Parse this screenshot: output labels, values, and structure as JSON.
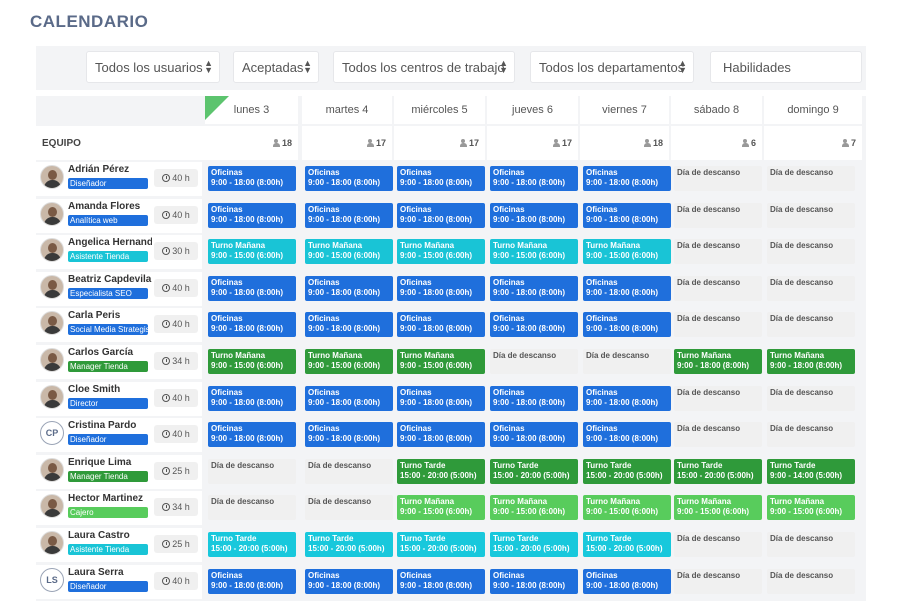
{
  "page_title": "CALENDARIO",
  "filters": [
    {
      "label": "Todos los usuarios",
      "dropdown": true
    },
    {
      "label": "Aceptadas",
      "dropdown": true
    },
    {
      "label": "Todos los centros de trabajo",
      "dropdown": true
    },
    {
      "label": "Todos los departamentos",
      "dropdown": true
    },
    {
      "label": "Habilidades",
      "dropdown": false
    }
  ],
  "team_header": "EQUIPO",
  "days": [
    {
      "label": "lunes 3",
      "count": "18"
    },
    {
      "label": "martes 4",
      "count": "17"
    },
    {
      "label": "miércoles 5",
      "count": "17"
    },
    {
      "label": "jueves 6",
      "count": "17"
    },
    {
      "label": "viernes 7",
      "count": "18"
    },
    {
      "label": "sábado 8",
      "count": "6"
    },
    {
      "label": "domingo 9",
      "count": "7"
    }
  ],
  "shift_colors": {
    "O": "#1f6fdc",
    "M": "#19c4d6",
    "MD": "#2f9a3a",
    "T": "#18c8dc",
    "TD": "#2f9a3a",
    "ML": "#58cc5c",
    "R": "#f0f0f0"
  },
  "shift_text": {
    "O": [
      "Oficinas",
      "9:00 - 18:00 (8:00h)"
    ],
    "M": [
      "Turno Mañana",
      "9:00 - 15:00 (6:00h)"
    ],
    "MD": [
      "Turno Mañana",
      "9:00 - 15:00 (6:00h)"
    ],
    "MD8": [
      "Turno Mañana",
      "9:00 - 18:00 (8:00h)"
    ],
    "T": [
      "Turno Tarde",
      "15:00 - 20:00 (5:00h)"
    ],
    "TD": [
      "Turno Tarde",
      "15:00 - 20:00 (5:00h)"
    ],
    "TD9": [
      "Turno Tarde",
      "9:00 - 14:00 (5:00h)"
    ],
    "ML": [
      "Turno Mañana",
      "9:00 - 15:00 (6:00h)"
    ],
    "R": [
      "Día de descanso",
      ""
    ]
  },
  "employees": [
    {
      "name": "Adrián Pérez",
      "role": "Diseñador",
      "role_color": "#1f6fdc",
      "hours": "40 h",
      "avatar": "photo",
      "initials": "",
      "shifts": [
        "O",
        "O",
        "O",
        "O",
        "O",
        "R",
        "R"
      ]
    },
    {
      "name": "Amanda Flores",
      "role": "Analítica web",
      "role_color": "#1f6fdc",
      "hours": "40 h",
      "avatar": "photo",
      "initials": "",
      "shifts": [
        "O",
        "O",
        "O",
        "O",
        "O",
        "R",
        "R"
      ]
    },
    {
      "name": "Angelica Hernandez",
      "role": "Asistente Tienda",
      "role_color": "#19c4d6",
      "hours": "30 h",
      "avatar": "photo",
      "initials": "",
      "shifts": [
        "M",
        "M",
        "M",
        "M",
        "M",
        "R",
        "R"
      ]
    },
    {
      "name": "Beatriz Capdevila",
      "role": "Especialista SEO",
      "role_color": "#1f6fdc",
      "hours": "40 h",
      "avatar": "photo",
      "initials": "",
      "shifts": [
        "O",
        "O",
        "O",
        "O",
        "O",
        "R",
        "R"
      ]
    },
    {
      "name": "Carla Peris",
      "role": "Social Media Strategist",
      "role_color": "#1f6fdc",
      "hours": "40 h",
      "avatar": "photo",
      "initials": "",
      "shifts": [
        "O",
        "O",
        "O",
        "O",
        "O",
        "R",
        "R"
      ]
    },
    {
      "name": "Carlos García",
      "role": "Manager Tienda",
      "role_color": "#2f9a3a",
      "hours": "34 h",
      "avatar": "photo",
      "initials": "",
      "shifts": [
        "MD",
        "MD",
        "MD",
        "R",
        "R",
        "MD8",
        "MD8"
      ]
    },
    {
      "name": "Cloe Smith",
      "role": "Director",
      "role_color": "#1f6fdc",
      "hours": "40 h",
      "avatar": "photo",
      "initials": "",
      "shifts": [
        "O",
        "O",
        "O",
        "O",
        "O",
        "R",
        "R"
      ]
    },
    {
      "name": "Cristina Pardo",
      "role": "Diseñador",
      "role_color": "#1f6fdc",
      "hours": "40 h",
      "avatar": "init",
      "initials": "CP",
      "shifts": [
        "O",
        "O",
        "O",
        "O",
        "O",
        "R",
        "R"
      ]
    },
    {
      "name": "Enrique Lima",
      "role": "Manager Tienda",
      "role_color": "#2f9a3a",
      "hours": "25 h",
      "avatar": "photo",
      "initials": "",
      "shifts": [
        "R",
        "R",
        "TD",
        "TD",
        "TD",
        "TD",
        "TD9"
      ]
    },
    {
      "name": "Hector Martinez",
      "role": "Cajero",
      "role_color": "#58cc5c",
      "hours": "34 h",
      "avatar": "photo",
      "initials": "",
      "shifts": [
        "R",
        "R",
        "ML",
        "ML",
        "ML",
        "ML",
        "ML"
      ]
    },
    {
      "name": "Laura Castro",
      "role": "Asistente Tienda",
      "role_color": "#19c4d6",
      "hours": "25 h",
      "avatar": "photo",
      "initials": "",
      "shifts": [
        "T",
        "T",
        "T",
        "T",
        "T",
        "R",
        "R"
      ]
    },
    {
      "name": "Laura Serra",
      "role": "Diseñador",
      "role_color": "#1f6fdc",
      "hours": "40 h",
      "avatar": "init",
      "initials": "LS",
      "shifts": [
        "O",
        "O",
        "O",
        "O",
        "O",
        "R",
        "R"
      ]
    }
  ]
}
